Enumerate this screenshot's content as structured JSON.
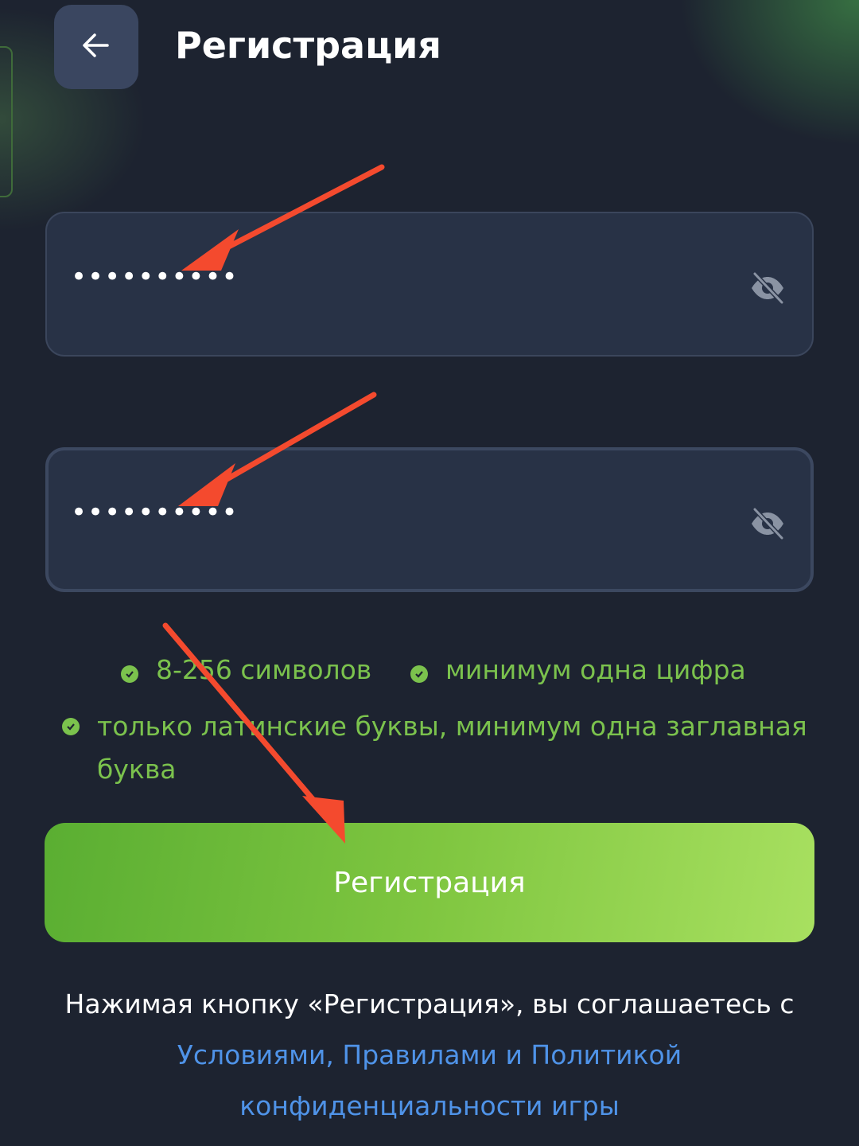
{
  "header": {
    "title": "Регистрация",
    "back_icon": "arrow-left-icon"
  },
  "password_field": {
    "value": "••••••••••",
    "toggle_icon": "eye-off-icon"
  },
  "confirm_password_field": {
    "value": "••••••••••",
    "toggle_icon": "eye-off-icon"
  },
  "requirements": [
    {
      "text": "8-256 символов",
      "met": true
    },
    {
      "text": "минимум одна цифра",
      "met": true
    },
    {
      "text": "только латинские буквы, минимум одна заглавная буква",
      "met": true
    }
  ],
  "submit_label": "Регистрация",
  "terms": {
    "prefix": "Нажимая кнопку «Регистрация», вы соглашаетесь с",
    "link_conditions": "Условиями",
    "link_rules": "Правилами",
    "and_word": "и",
    "link_policy": "Политикой конфиденциальности игры"
  },
  "colors": {
    "background": "#1d2330",
    "accent_green": "#7bc24d",
    "link_blue": "#4f93e8",
    "annotation_arrow": "#f44a2e"
  }
}
